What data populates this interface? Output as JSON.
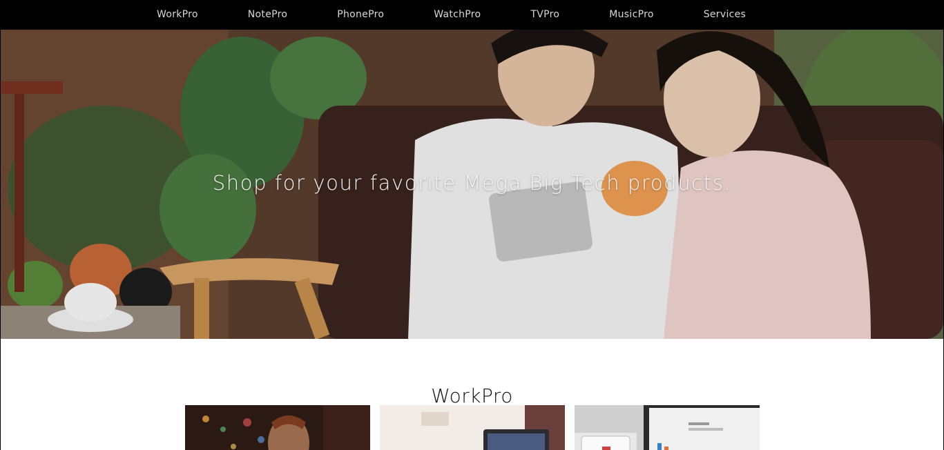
{
  "nav": {
    "items": [
      {
        "label": "WorkPro"
      },
      {
        "label": "NotePro"
      },
      {
        "label": "PhonePro"
      },
      {
        "label": "WatchPro"
      },
      {
        "label": "TVPro"
      },
      {
        "label": "MusicPro"
      },
      {
        "label": "Services"
      }
    ]
  },
  "hero": {
    "tagline": "Shop for your favorite Mega Big Tech products."
  },
  "section": {
    "title": "WorkPro",
    "cards": [
      {
        "image": "man-with-laptop-photo"
      },
      {
        "image": "laptop-on-desk-photo"
      },
      {
        "image": "tablet-and-monitor-photo"
      }
    ]
  },
  "colors": {
    "nav_background": "#000000",
    "nav_text": "#d8d8d8",
    "page_background": "#ffffff"
  }
}
